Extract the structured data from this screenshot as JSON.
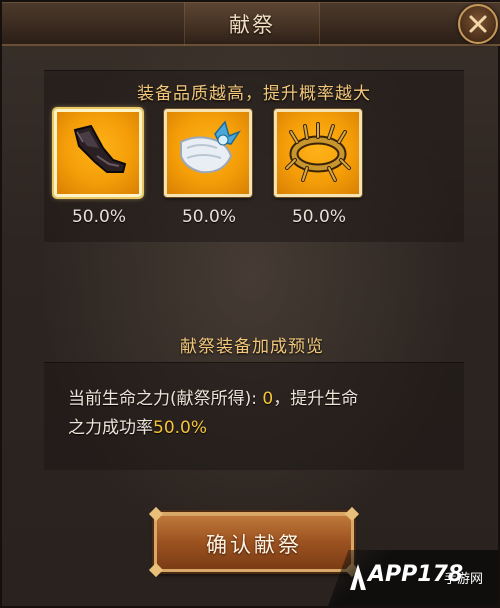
{
  "window": {
    "title": "献祭"
  },
  "slots_section": {
    "heading": "装备品质越高，提升概率越大",
    "items": [
      {
        "icon": "gauntlet-icon",
        "percent": "50.0%"
      },
      {
        "icon": "scarf-icon",
        "percent": "50.0%"
      },
      {
        "icon": "crown-icon",
        "percent": "50.0%"
      }
    ]
  },
  "preview_section": {
    "heading": "献祭装备加成预览",
    "line1_prefix": "当前生命之力(献祭所得): ",
    "line1_value": "0",
    "line1_suffix": "，提升生命",
    "line2_prefix": "之力成功率",
    "line2_value": "50.0%"
  },
  "confirm_label": "确认献祭",
  "watermark": {
    "text": "APP178",
    "sub": "手游网"
  },
  "colors": {
    "accent": "#f2c77a",
    "highlight": "#f5c33a",
    "slot_bg": "#f49d08"
  }
}
